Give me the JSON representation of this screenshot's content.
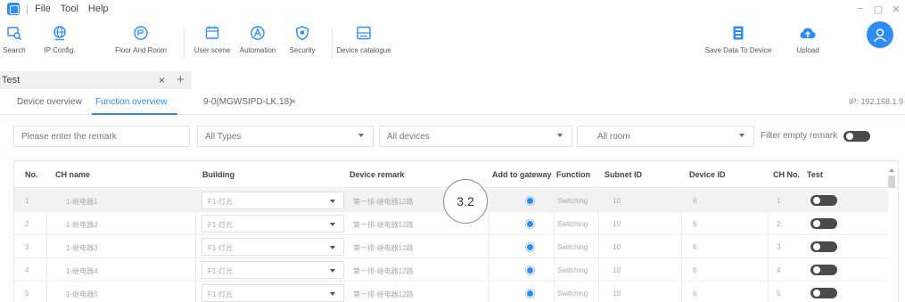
{
  "menu": {
    "file": "File",
    "tool": "Tool",
    "help": "Help"
  },
  "window_controls": {
    "minimize": "−",
    "restore": "▢",
    "close": "✕"
  },
  "toolbar": {
    "search": "Search",
    "ip_config": "IP Config.",
    "floor_room": "Floor And Room",
    "user_scene": "User scene",
    "automation": "Automation",
    "security": "Security",
    "device_catalogue": "Device catalogue",
    "save_data": "Save Data To Device",
    "upload": "Upload"
  },
  "workspace_tab": {
    "label": "Test",
    "close": "×",
    "add": "+"
  },
  "subtabs": {
    "device_overview": "Device overview",
    "function_overview": "Function overview",
    "device_tab": "9-0(MGWSIPD-LK.18)",
    "device_tab_close": "×",
    "ip": "IP: 192.168.1.9"
  },
  "filters": {
    "remark_placeholder": "Please enter the remark",
    "types": "All Types",
    "devices": "All devices",
    "room": "All room",
    "filter_empty": "Filter empty remark"
  },
  "table": {
    "headers": {
      "no": "No.",
      "ch_name": "CH name",
      "building": "Building",
      "device_remark": "Device remark",
      "add_to_gateway": "Add to gateway",
      "function": "Function",
      "subnet_id": "Subnet ID",
      "device_id": "Device ID",
      "ch_no": "CH No.",
      "test": "Test"
    },
    "rows": [
      {
        "no": "1",
        "ch_name": "1-继电器1",
        "building": "F1-灯光",
        "remark": "第一排-继电器12路",
        "function": "Switching",
        "subnet": "10",
        "device": "6",
        "ch": "1"
      },
      {
        "no": "2",
        "ch_name": "1-继电器2",
        "building": "F1-灯光",
        "remark": "第一排-继电器12路",
        "function": "Switching",
        "subnet": "10",
        "device": "6",
        "ch": "2"
      },
      {
        "no": "3",
        "ch_name": "1-继电器3",
        "building": "F1-灯光",
        "remark": "第一排-继电器12路",
        "function": "Switching",
        "subnet": "10",
        "device": "6",
        "ch": "3"
      },
      {
        "no": "4",
        "ch_name": "1-继电器4",
        "building": "F1-灯光",
        "remark": "第一排-继电器12路",
        "function": "Switching",
        "subnet": "10",
        "device": "6",
        "ch": "4"
      },
      {
        "no": "5",
        "ch_name": "1-继电器5",
        "building": "F1-灯光",
        "remark": "第一排-继电器12路",
        "function": "Switching",
        "subnet": "10",
        "device": "6",
        "ch": "5"
      }
    ]
  },
  "callout": "3.2",
  "colors": {
    "accent": "#2f8cf2",
    "toggle_off": "#4a4a4a",
    "row_highlight": "#f2f2f2"
  },
  "icons": {
    "search": "search-icon",
    "ip_config": "globe-icon",
    "floor_room": "floor-icon",
    "user_scene": "scene-icon",
    "automation": "automation-icon",
    "security": "shield-icon",
    "device_catalogue": "catalogue-icon",
    "save_data": "save-device-icon",
    "upload": "upload-icon",
    "avatar": "user-icon"
  }
}
